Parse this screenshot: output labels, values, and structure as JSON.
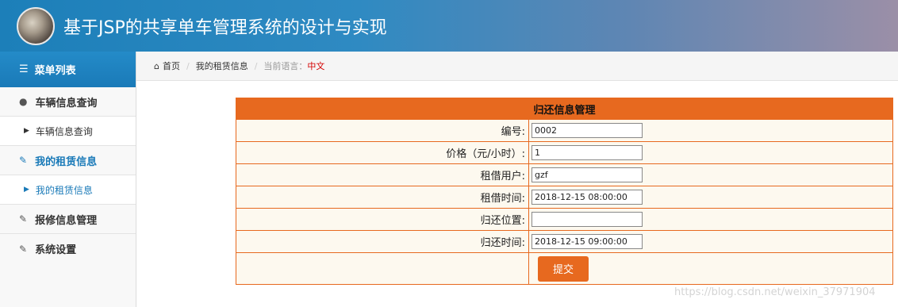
{
  "header": {
    "title": "基于JSP的共享单车管理系统的设计与实现"
  },
  "sidebar": {
    "heading": "菜单列表",
    "items": [
      {
        "label": "车辆信息查询",
        "type": "group"
      },
      {
        "label": "车辆信息查询",
        "type": "sub"
      },
      {
        "label": "我的租赁信息",
        "type": "group",
        "active": true
      },
      {
        "label": "我的租赁信息",
        "type": "sub",
        "active": true
      },
      {
        "label": "报修信息管理",
        "type": "group"
      },
      {
        "label": "系统设置",
        "type": "group"
      }
    ]
  },
  "breadcrumb": {
    "home": "首页",
    "current": "我的租赁信息",
    "lang_label": "当前语言：",
    "lang_value": "中文"
  },
  "form": {
    "title": "归还信息管理",
    "fields": [
      {
        "label": "编号:",
        "value": "0002"
      },
      {
        "label": "价格（元/小时）:",
        "value": "1"
      },
      {
        "label": "租借用户:",
        "value": "gzf"
      },
      {
        "label": "租借时间:",
        "value": "2018-12-15 08:00:00"
      },
      {
        "label": "归还位置:",
        "value": ""
      },
      {
        "label": "归还时间:",
        "value": "2018-12-15 09:00:00"
      }
    ],
    "submit_label": "提交"
  },
  "watermark": "https://blog.csdn.net/weixin_37971904",
  "colors": {
    "accent": "#e7691f",
    "brand": "#1a7ab8",
    "lang": "#d40000"
  }
}
